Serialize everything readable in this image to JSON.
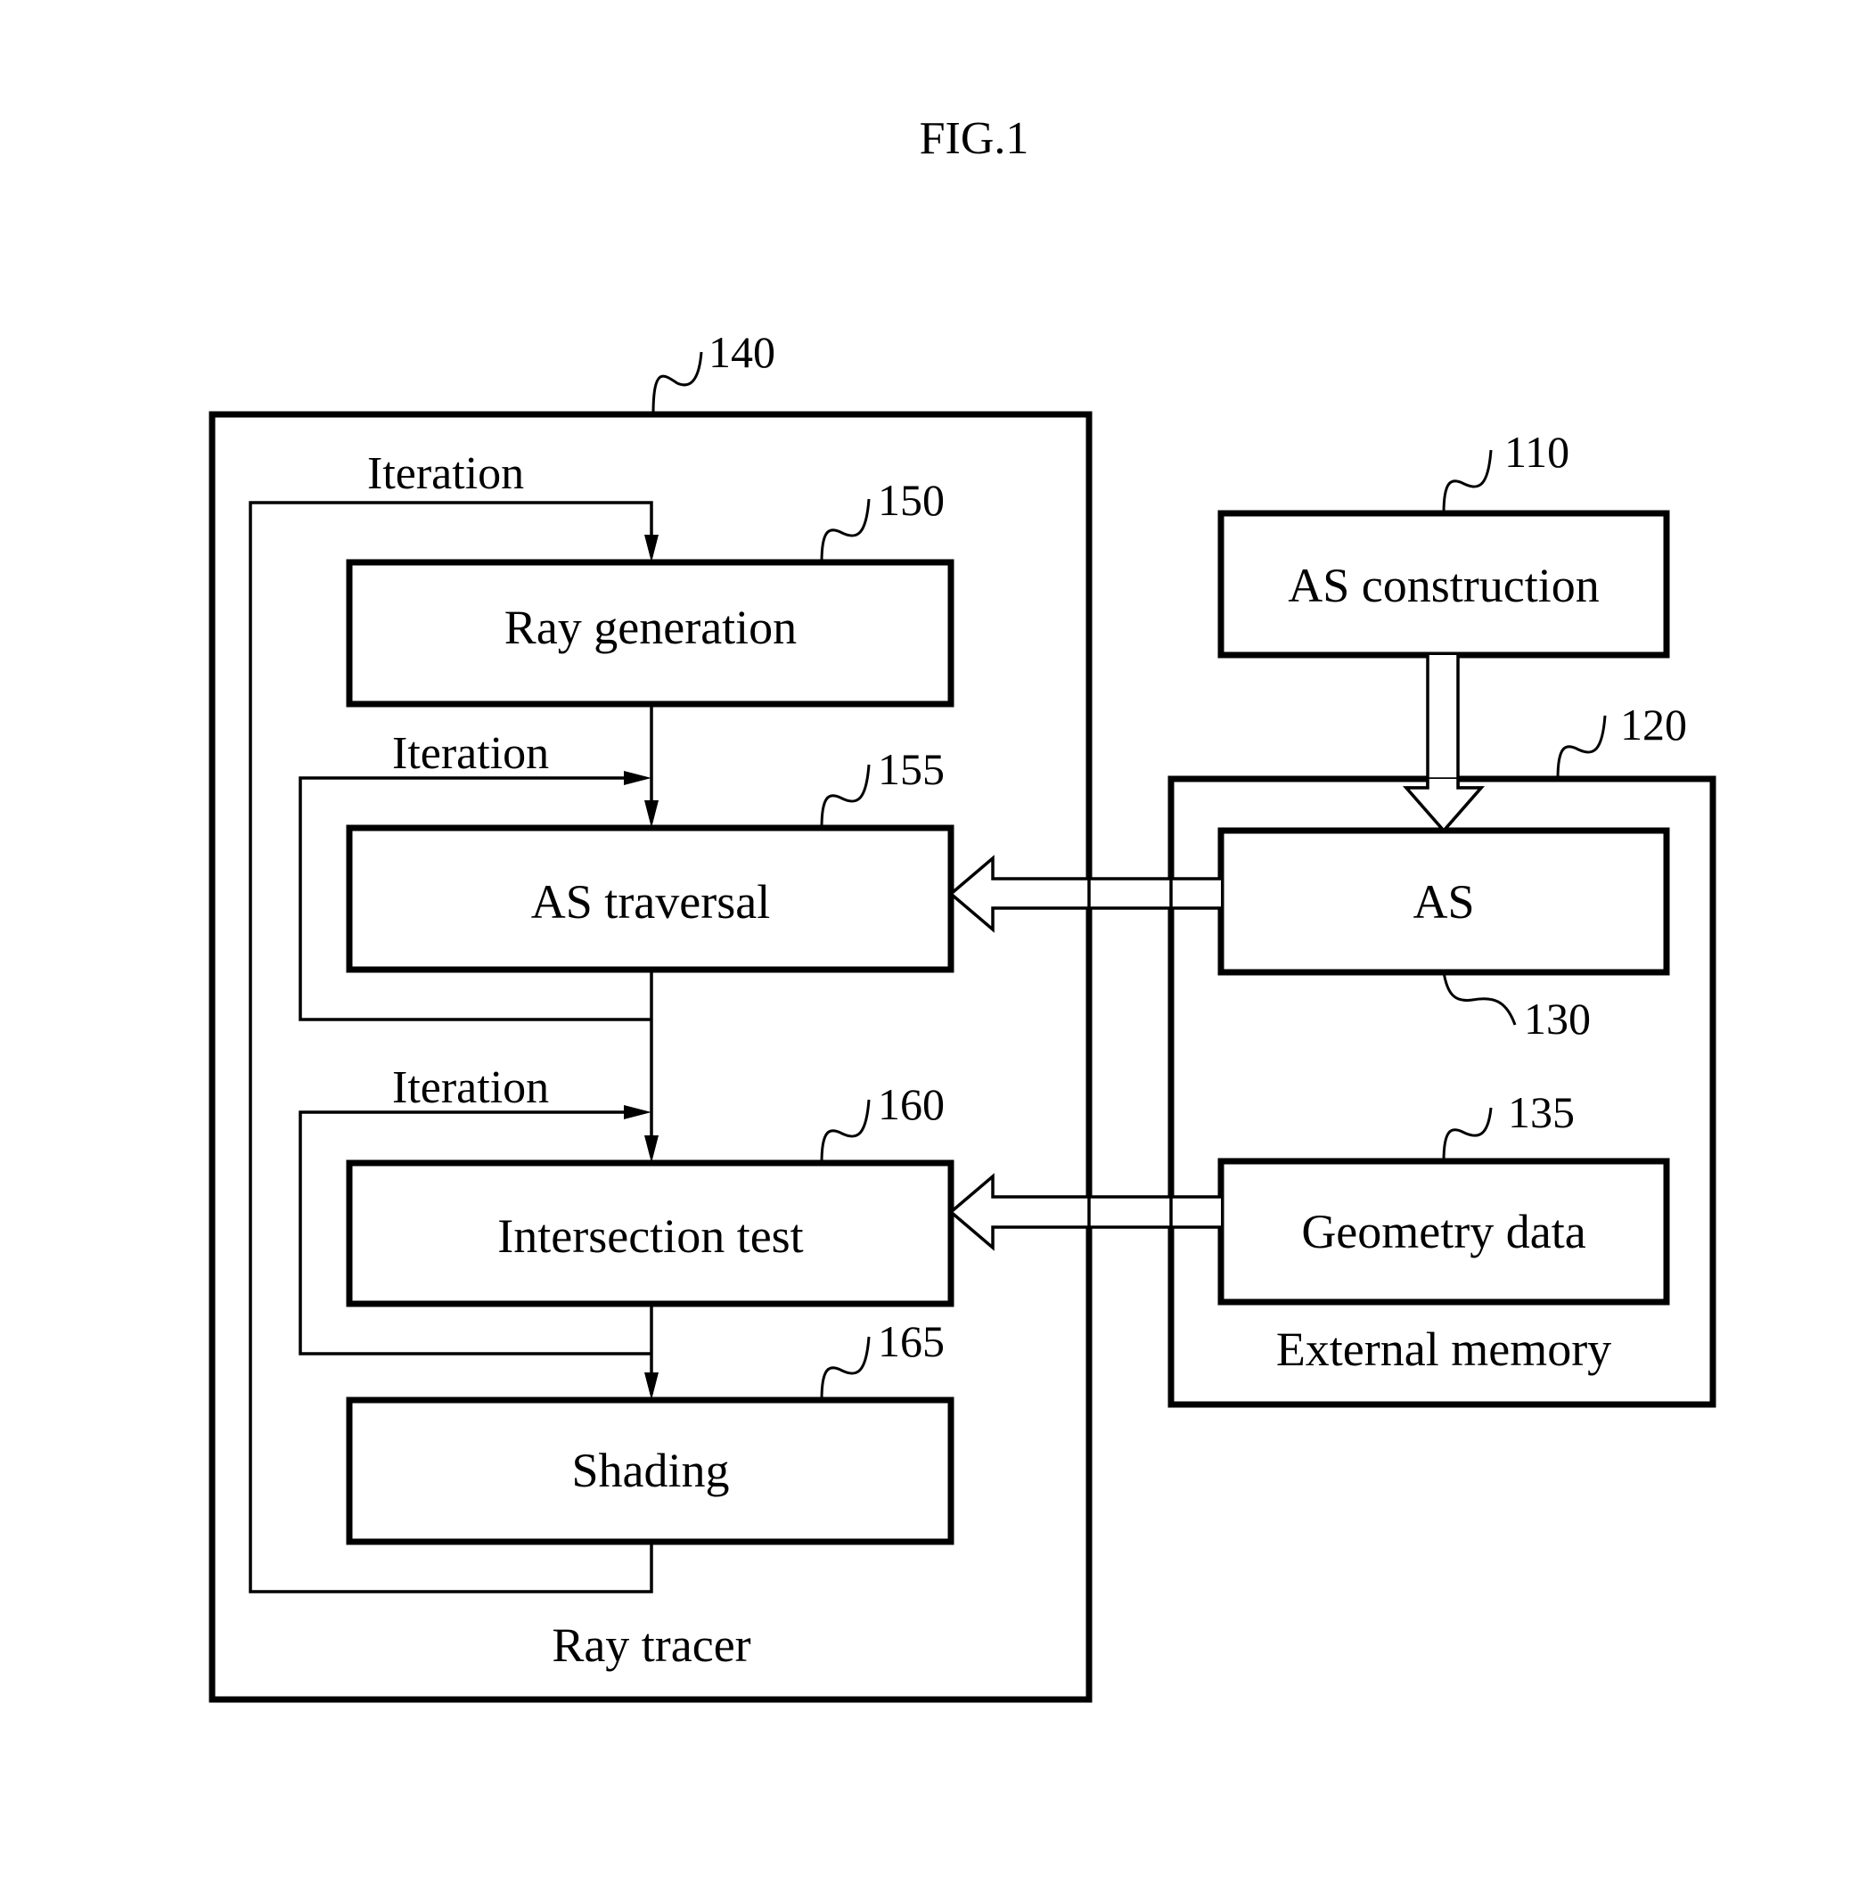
{
  "figure": {
    "title": "FIG.1"
  },
  "ray_tracer": {
    "ref": "140",
    "label": "Ray tracer",
    "iteration_labels": [
      "Iteration",
      "Iteration",
      "Iteration"
    ],
    "stages": [
      {
        "ref": "150",
        "label": "Ray generation"
      },
      {
        "ref": "155",
        "label": "AS traversal"
      },
      {
        "ref": "160",
        "label": "Intersection test"
      },
      {
        "ref": "165",
        "label": "Shading"
      }
    ]
  },
  "as_construction": {
    "ref": "110",
    "label": "AS construction"
  },
  "external_memory": {
    "ref": "120",
    "label": "External memory",
    "items": [
      {
        "ref": "130",
        "label": "AS"
      },
      {
        "ref": "135",
        "label": "Geometry data"
      }
    ]
  },
  "connections": [
    {
      "from": "AS construction",
      "to": "AS",
      "style": "hollow-arrow"
    },
    {
      "from": "AS",
      "to": "AS traversal",
      "style": "hollow-arrow"
    },
    {
      "from": "Geometry data",
      "to": "Intersection test",
      "style": "hollow-arrow"
    },
    {
      "from": "Ray generation",
      "to": "AS traversal",
      "style": "arrow"
    },
    {
      "from": "AS traversal",
      "to": "Intersection test",
      "style": "arrow"
    },
    {
      "from": "Intersection test",
      "to": "Shading",
      "style": "arrow"
    },
    {
      "from": "Shading",
      "to": "Ray generation",
      "style": "iteration-loop"
    },
    {
      "from": "AS traversal",
      "to": "AS traversal",
      "style": "iteration-loop"
    },
    {
      "from": "Intersection test",
      "to": "Intersection test",
      "style": "iteration-loop"
    }
  ]
}
